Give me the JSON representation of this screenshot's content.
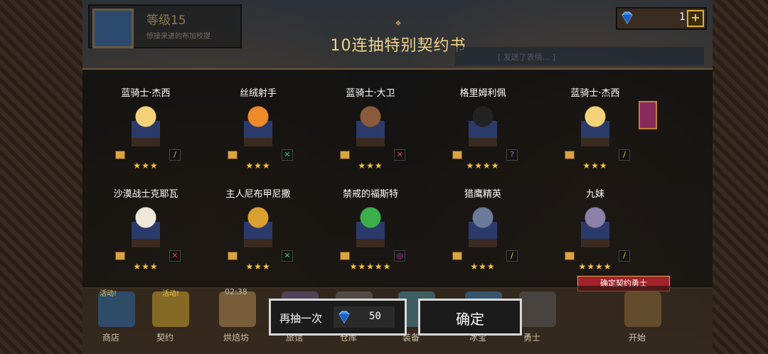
{
  "player": {
    "level": "等级15",
    "tagline": "惊接来进的布加校提"
  },
  "currency": {
    "gems": "1",
    "plus": "+"
  },
  "panel": {
    "title": "10连抽特别契约书",
    "hint": "[ 发送了表情... ]"
  },
  "heroes": [
    {
      "name": "蓝骑士·杰西",
      "stars": "★★★",
      "weapon": "sword",
      "weapon_color": "#f2c84a"
    },
    {
      "name": "丝绒射手",
      "stars": "★★★",
      "weapon": "bow",
      "weapon_color": "#3cd05a"
    },
    {
      "name": "蓝骑士·大卫",
      "stars": "★★★",
      "weapon": "cross",
      "weapon_color": "#e43a3a"
    },
    {
      "name": "格里姆利佩",
      "stars": "★★★★",
      "weapon": "staff",
      "weapon_color": "#b06ae0"
    },
    {
      "name": "蓝骑士·杰西",
      "stars": "★★★",
      "weapon": "sword",
      "weapon_color": "#f2c84a"
    },
    {
      "name": "沙漠战士克耶瓦",
      "stars": "★★★",
      "weapon": "cross",
      "weapon_color": "#e43a3a"
    },
    {
      "name": "主人尼布甲尼撒",
      "stars": "★★★",
      "weapon": "bow",
      "weapon_color": "#3cd05a"
    },
    {
      "name": "禁戒的福斯特",
      "stars": "★★★★★",
      "weapon": "orb",
      "weapon_color": "#e040c0"
    },
    {
      "name": "猎鹰精英",
      "stars": "★★★",
      "weapon": "sword",
      "weapon_color": "#f2c84a"
    },
    {
      "name": "九妹",
      "stars": "★★★★",
      "weapon": "sword",
      "weapon_color": "#f2c84a"
    }
  ],
  "confirm_tag": "确定契约勇士",
  "buttons": {
    "draw_again": "再抽一次",
    "draw_cost": "50",
    "confirm": "确定"
  },
  "nav": {
    "timer": "02:38",
    "items": [
      "商店",
      "契约",
      "烘焙坊",
      "旅馆",
      "仓库",
      "装备",
      "冰宝",
      "勇士",
      "开始"
    ],
    "badges": [
      "活动!",
      "活动!"
    ]
  }
}
